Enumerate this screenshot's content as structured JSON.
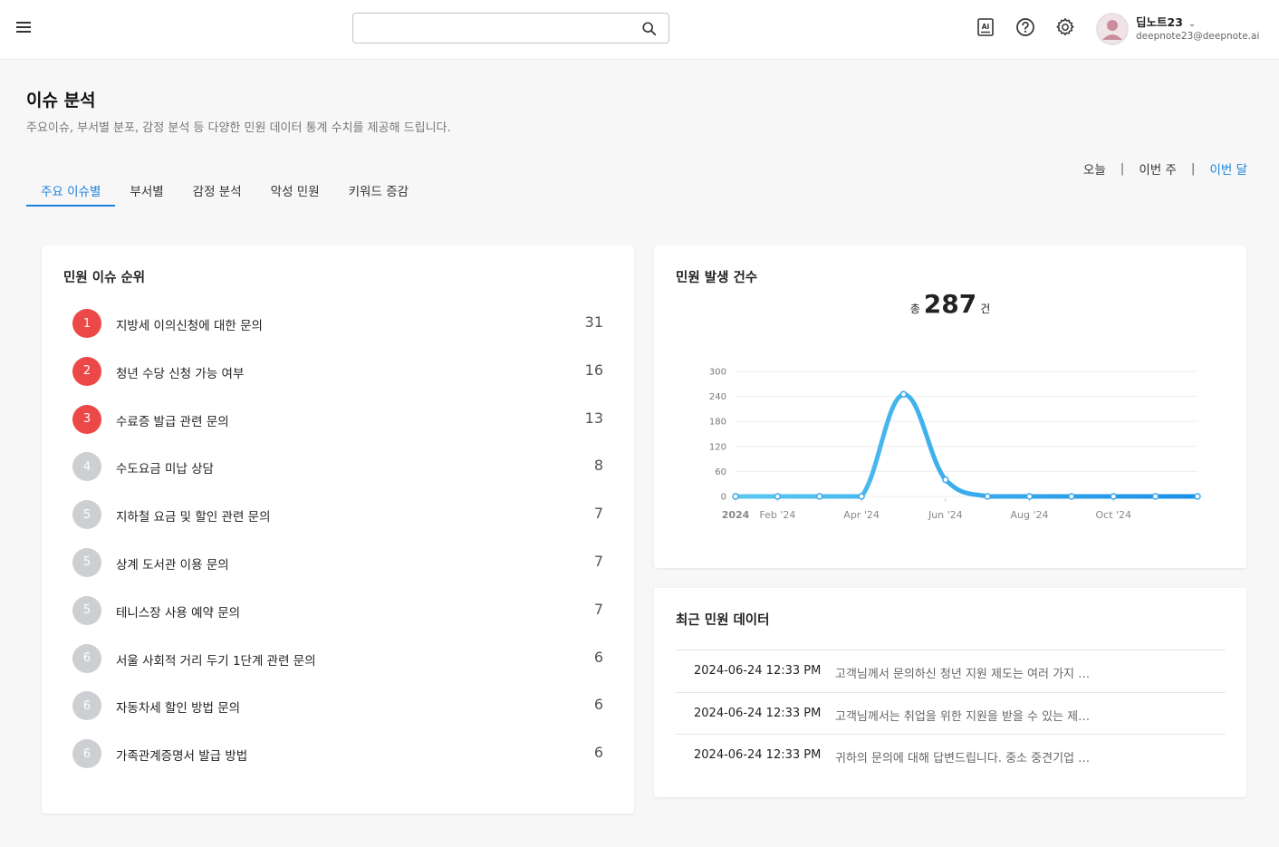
{
  "header": {
    "search_placeholder": "",
    "icons": [
      "menu-icon",
      "search-icon",
      "ai-icon",
      "help-icon",
      "gear-icon"
    ],
    "user": {
      "name": "딥노트23",
      "email": "deepnote23@deepnote.ai"
    }
  },
  "page": {
    "title": "이슈 분석",
    "subtitle": "주요이슈, 부서별 분포, 감정 분석 등 다양한 민원 데이터 통계 수치를 제공해 드립니다."
  },
  "tabs": [
    {
      "label": "주요 이슈별",
      "active": true
    },
    {
      "label": "부서별",
      "active": false
    },
    {
      "label": "감정 분석",
      "active": false
    },
    {
      "label": "악성 민원",
      "active": false
    },
    {
      "label": "키워드 증감",
      "active": false
    }
  ],
  "period": {
    "options": [
      "오늘",
      "이번 주",
      "이번 달"
    ],
    "separator": "|",
    "active": "이번 달"
  },
  "ranking": {
    "title": "민원 이슈 순위",
    "items": [
      {
        "rank": "1",
        "label": "지방세 이의신청에 대한 문의",
        "count": "31"
      },
      {
        "rank": "2",
        "label": "청년 수당 신청 가능 여부",
        "count": "16"
      },
      {
        "rank": "3",
        "label": "수료증 발급 관련 문의",
        "count": "13"
      },
      {
        "rank": "4",
        "label": "수도요금 미납 상담",
        "count": "8"
      },
      {
        "rank": "5",
        "label": "지하철 요금 및 할인 관련 문의",
        "count": "7"
      },
      {
        "rank": "5",
        "label": "상계 도서관 이용 문의",
        "count": "7"
      },
      {
        "rank": "5",
        "label": "테니스장 사용 예약 문의",
        "count": "7"
      },
      {
        "rank": "6",
        "label": "서울 사회적 거리 두기 1단계 관련 문의",
        "count": "6"
      },
      {
        "rank": "6",
        "label": "자동차세 할인 방법 문의",
        "count": "6"
      },
      {
        "rank": "6",
        "label": "가족관계증명서 발급 방법",
        "count": "6"
      }
    ]
  },
  "occurrence": {
    "title": "민원 발생 건수",
    "total_prefix": "총",
    "total": "287",
    "total_suffix": "건"
  },
  "chart_data": {
    "type": "line",
    "title": "",
    "xlabel": "",
    "ylabel": "",
    "x": [
      "2024-01",
      "2024-02",
      "2024-03",
      "2024-04",
      "2024-05",
      "2024-06",
      "2024-07",
      "2024-08",
      "2024-09",
      "2024-10",
      "2024-11",
      "2024-12"
    ],
    "series": [
      {
        "values": [
          0,
          0,
          0,
          0,
          245,
          40,
          0,
          0,
          0,
          0,
          0,
          0
        ]
      }
    ],
    "ylim": [
      0,
      300
    ],
    "yticks": [
      "0",
      "60",
      "120",
      "180",
      "240",
      "300"
    ],
    "xticks": [
      {
        "x": "2024-01",
        "label": "2024"
      },
      {
        "x": "2024-02",
        "label": "Feb '24"
      },
      {
        "x": "2024-04",
        "label": "Apr '24"
      },
      {
        "x": "2024-06",
        "label": "Jun '24"
      },
      {
        "x": "2024-08",
        "label": "Aug '24"
      },
      {
        "x": "2024-10",
        "label": "Oct '24"
      }
    ],
    "grid": true,
    "colors": {
      "line_start": "#5bc8f0",
      "line_end": "#1a8fe8"
    }
  },
  "recent": {
    "title": "최근 민원 데이터",
    "rows": [
      {
        "datetime": "2024-06-24 12:33 PM",
        "message": "고객님께서 문의하신 청년 지원 제도는 여러 가지 형태로 제공됩니다"
      },
      {
        "datetime": "2024-06-24 12:33 PM",
        "message": "고객님께서는 취업을 위한 지원을 받을 수 있는 제도가 있습니다"
      },
      {
        "datetime": "2024-06-24 12:33 PM",
        "message": "귀하의 문의에 대해 답변드립니다. 중소 중견기업 청년 지원"
      }
    ]
  },
  "colors": {
    "accent": "#1d82d9",
    "rank_hot": "#ec4848",
    "rank_cold": "#cdcfd3"
  }
}
